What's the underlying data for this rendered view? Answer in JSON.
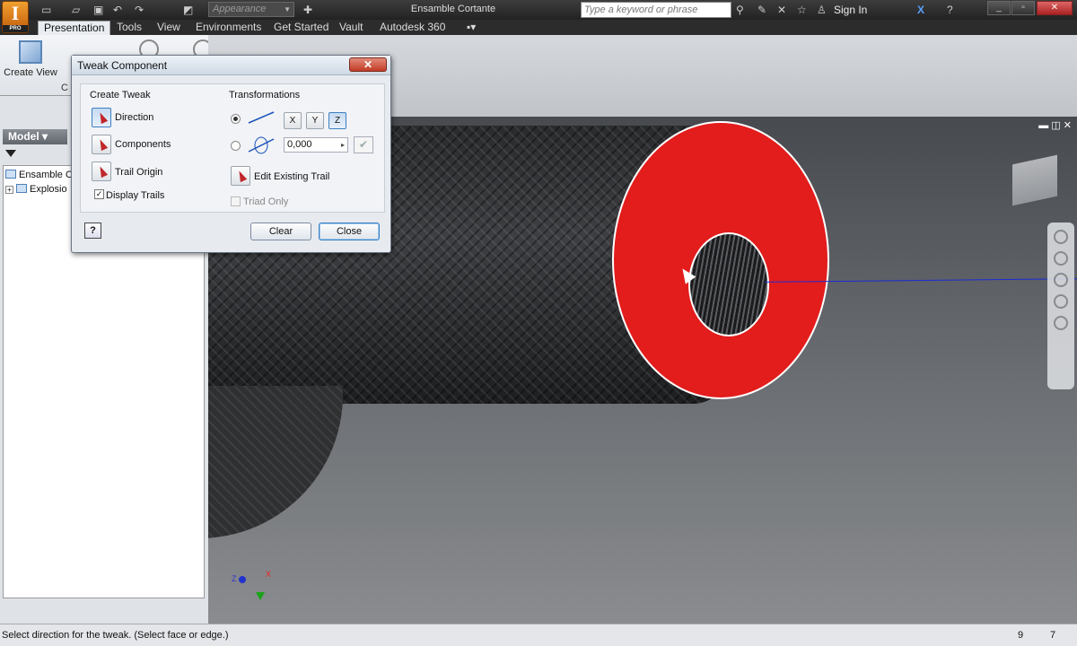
{
  "titlebar": {
    "app_logo": "I",
    "app_logo_badge": "PRO",
    "appearance_placeholder": "Appearance",
    "document_title": "Ensamble Cortante",
    "search_placeholder": "Type a keyword or phrase",
    "sign_in": "Sign In"
  },
  "tabs": [
    {
      "label": "Presentation",
      "active": true
    },
    {
      "label": "Tools"
    },
    {
      "label": "View"
    },
    {
      "label": "Environments"
    },
    {
      "label": "Get Started"
    },
    {
      "label": "Vault"
    },
    {
      "label": "Autodesk 360"
    }
  ],
  "ribbon": {
    "create_view": "Create View",
    "partial_label": "C"
  },
  "browser": {
    "header": "Model",
    "tree": [
      {
        "label": "Ensamble C"
      },
      {
        "label": "Explosio"
      }
    ]
  },
  "dialog": {
    "title": "Tweak Component",
    "close_symbol": "✕",
    "create_tweak": {
      "title": "Create Tweak",
      "direction": "Direction",
      "components": "Components",
      "trail_origin": "Trail Origin",
      "display_trails": "Display Trails",
      "display_trails_checked": true
    },
    "transformations": {
      "title": "Transformations",
      "axes": [
        "X",
        "Y",
        "Z"
      ],
      "selected_axis": "Z",
      "angle_value": "0,000",
      "edit_existing_trail": "Edit Existing Trail",
      "triad_only": "Triad Only"
    },
    "help": "?",
    "clear": "Clear",
    "close": "Close"
  },
  "viewport": {
    "triad_x": "X",
    "triad_z": "Z"
  },
  "status": {
    "message": "Select direction for the tweak. (Select face or edge.)",
    "count1": "9",
    "count2": "7"
  },
  "colors": {
    "selected_face": "#e31c1c",
    "axis_line": "#1b2bd6"
  }
}
